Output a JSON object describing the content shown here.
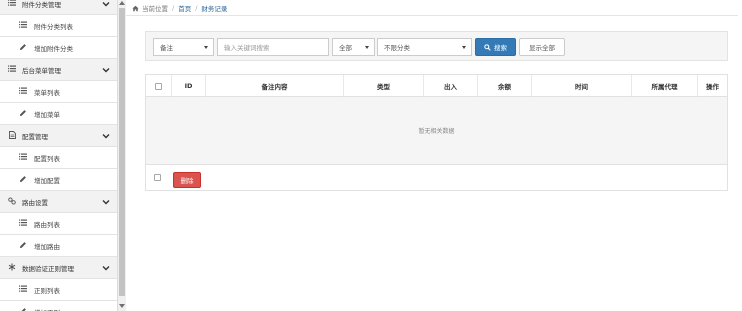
{
  "sidebar": {
    "items": [
      {
        "kind": "group",
        "icon": "list-icon",
        "label": "附件分类管理"
      },
      {
        "kind": "sub",
        "icon": "list-icon",
        "label": "附件分类列表"
      },
      {
        "kind": "sub",
        "icon": "pencil-icon",
        "label": "增加附件分类"
      },
      {
        "kind": "group",
        "icon": "list-icon",
        "label": "后台菜单管理"
      },
      {
        "kind": "sub",
        "icon": "list-icon",
        "label": "菜单列表"
      },
      {
        "kind": "sub",
        "icon": "pencil-icon",
        "label": "增加菜单"
      },
      {
        "kind": "group",
        "icon": "file-icon",
        "label": "配置管理"
      },
      {
        "kind": "sub",
        "icon": "list-icon",
        "label": "配置列表"
      },
      {
        "kind": "sub",
        "icon": "pencil-icon",
        "label": "增加配置"
      },
      {
        "kind": "group",
        "icon": "link-icon",
        "label": "路由设置"
      },
      {
        "kind": "sub",
        "icon": "list-icon",
        "label": "路由列表"
      },
      {
        "kind": "sub",
        "icon": "pencil-icon",
        "label": "增加路由"
      },
      {
        "kind": "group",
        "icon": "asterisk-icon",
        "label": "数据验证正则管理"
      },
      {
        "kind": "sub",
        "icon": "list-icon",
        "label": "正则列表"
      },
      {
        "kind": "sub",
        "icon": "pencil-icon",
        "label": "增加正则"
      }
    ]
  },
  "breadcrumb": {
    "location": "当前位置",
    "home": "首页",
    "current": "财务记录"
  },
  "toolbar": {
    "field_select": "备注",
    "keyword_placeholder": "输入关键词搜索",
    "status_select": "全部",
    "category_select": "不限分类",
    "search_label": "搜索",
    "show_all_label": "显示全部"
  },
  "table": {
    "columns": [
      "ID",
      "备注内容",
      "类型",
      "出入",
      "余额",
      "时间",
      "所属代理",
      "操作"
    ],
    "empty_text": "暂无相关数据",
    "delete_label": "删除"
  },
  "colors": {
    "primary": "#337ab7",
    "danger": "#d9534f",
    "link": "#2a6496"
  }
}
